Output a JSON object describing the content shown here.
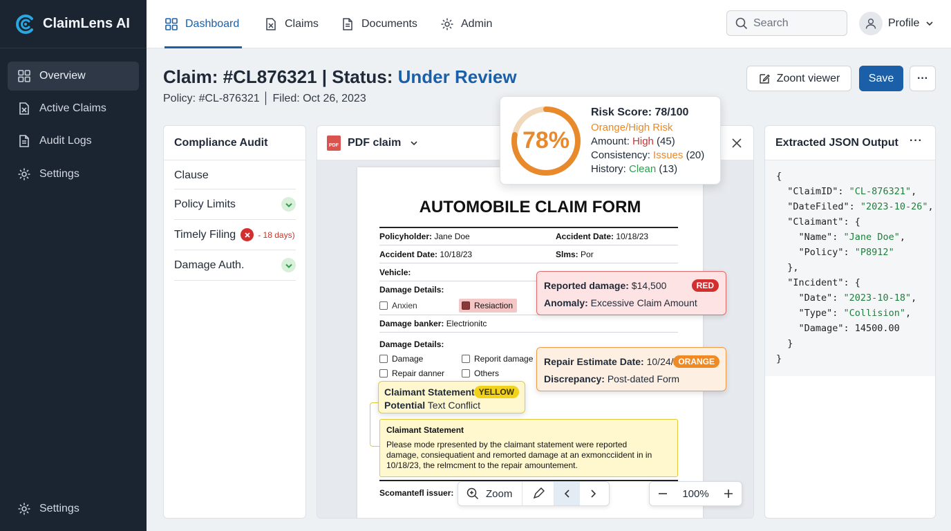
{
  "app": {
    "name": "ClaimLens AI"
  },
  "sidebar": {
    "items": [
      {
        "label": "Overview",
        "icon": "grid-icon",
        "active": true
      },
      {
        "label": "Active Claims",
        "icon": "claims-file-icon"
      },
      {
        "label": "Audit Logs",
        "icon": "document-icon"
      },
      {
        "label": "Settings",
        "icon": "gear-icon"
      }
    ],
    "footer_settings": "Settings"
  },
  "topnav": {
    "tabs": [
      {
        "label": "Dashboard",
        "icon": "grid-icon",
        "active": true
      },
      {
        "label": "Claims",
        "icon": "claims-file-icon"
      },
      {
        "label": "Documents",
        "icon": "document-icon"
      },
      {
        "label": "Admin",
        "icon": "gear-icon"
      }
    ],
    "search_placeholder": "Search",
    "profile_label": "Profile"
  },
  "claim": {
    "title_prefix": "Claim: #CL876321 | Status: ",
    "status": "Under Review",
    "subtitle": "Policy: #CL-876321 │ Filed: Oct 26, 2023"
  },
  "actions": {
    "viewer": "Zoont viewer",
    "save": "Save",
    "more": "···"
  },
  "compliance": {
    "title": "Compliance Audit",
    "header": "Clause",
    "rows": [
      {
        "label": "Policy Limits",
        "status": "pass"
      },
      {
        "label": "Timely Filing",
        "status": "fail",
        "note": "- 18 days)"
      },
      {
        "label": "Damage Auth.",
        "status": "pass"
      }
    ]
  },
  "viewer": {
    "title": "PDF claim",
    "pdf_badge": "PDF",
    "toolbar": {
      "zoom_label": "Zoom",
      "zoom_level": "100%"
    }
  },
  "form": {
    "title": "AUTOMOBILE CLAIM FORM",
    "policyholder_label": "Policyholder:",
    "policyholder": "Jane Doe",
    "accident_date_label": "Accident Date:",
    "accident_date": "10/18/23",
    "accident_date2": "10/18/23",
    "slms_label": "Slms:",
    "slms": "Por",
    "vehicle_label": "Vehicle:",
    "damage_details_label": "Damage Details:",
    "opt_anxien": "Anxien",
    "opt_resiaction": "Resiaction",
    "damage_banker_label": "Damage banker:",
    "damage_banker": "Electrionitc",
    "damage_details_label2": "Damage Details:",
    "opt_damage": "Damage",
    "opt_reporit": "Reporit damage",
    "opt_repair": "Repair danner",
    "opt_others": "Others",
    "statement_title": "Claimant Statement",
    "statement_text_1": "Please mode rpresented by the claimant statement were reported",
    "statement_text_2": "damage, consiequatient and remorted damage at an exmoncciident in in",
    "statement_text_3": "10/18/23, the relmcment to the repair amountement.",
    "footer_label": "Scomanteﬂ issuer:"
  },
  "risk": {
    "percent_text": "78%",
    "score": 0.78,
    "title": "Risk Score: 78/100",
    "level": "Orange/High Risk",
    "amount_label": "Amount: ",
    "amount_value": "High",
    "amount_score": " (45)",
    "consistency_label": "Consistency: ",
    "consistency_value": "Issues",
    "consistency_score": " (20)",
    "history_label": "History: ",
    "history_value": "Clean",
    "history_score": " (13)"
  },
  "flags": {
    "red": {
      "badge": "RED",
      "line1_label": "Reported damage:",
      "line1_value": " $14,500",
      "line2_label": "Anomaly:",
      "line2_value": " Excessive Claim Amount"
    },
    "orange": {
      "badge": "ORANGE",
      "line1_label": "Repair Estimate Date:",
      "line1_value": " 10/24/23",
      "line2_label": "Discrepancy:",
      "line2_value": " Post-dated Form"
    },
    "yellow": {
      "badge": "YELLOW",
      "line1_label": "Claimant Statement",
      "line2_label": "Potential",
      "line2_value": " Text Conflict"
    }
  },
  "json_output": {
    "title": "Extracted JSON Output",
    "lines": [
      "{",
      "  \"ClaimID\": \"CL-876321\",",
      "  \"DateFiled\": \"2023-10-26\",",
      "  \"Claimant\": {",
      "    \"Name\": \"Jane Doe\",",
      "    \"Policy\": \"P8912\"",
      "  },",
      "  \"Incident\": {",
      "    \"Date\": \"2023-10-18\",",
      "    \"Type\": \"Collision\",",
      "    \"Damage\": 14500.00",
      "  }",
      "}"
    ]
  },
  "colors": {
    "accent": "#1a5fa8",
    "sidebar": "#1b2431",
    "risk_orange": "#e8892b",
    "flag_red": "#d32f2f",
    "flag_orange": "#f08a24",
    "flag_yellow": "#f3d21c",
    "ok_green": "#2e9e4f"
  }
}
